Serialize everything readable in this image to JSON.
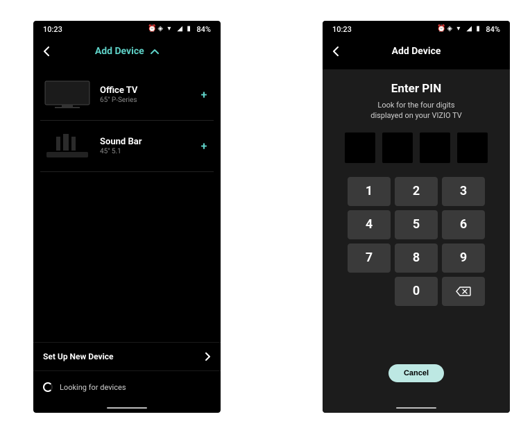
{
  "status": {
    "time": "10:23",
    "battery": "84%"
  },
  "left": {
    "header_title": "Add Device",
    "devices": [
      {
        "name": "Office TV",
        "sub": "65\" P-Series"
      },
      {
        "name": "Sound Bar",
        "sub": "45\" 5.1"
      }
    ],
    "setup_label": "Set Up New Device",
    "looking_label": "Looking for devices"
  },
  "right": {
    "header_title": "Add Device",
    "pin_title": "Enter PIN",
    "pin_sub_line1": "Look for the four digits",
    "pin_sub_line2": "displayed on your VIZIO TV",
    "keys": [
      "1",
      "2",
      "3",
      "4",
      "5",
      "6",
      "7",
      "8",
      "9",
      "0"
    ],
    "cancel_label": "Cancel"
  }
}
